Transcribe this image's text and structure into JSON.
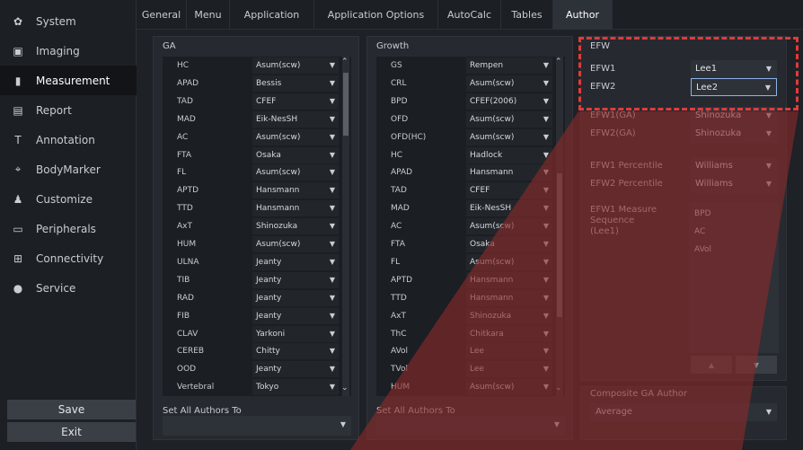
{
  "sidebar": {
    "items": [
      {
        "label": "System",
        "icon": "gear-icon"
      },
      {
        "label": "Imaging",
        "icon": "monitor-icon"
      },
      {
        "label": "Measurement",
        "icon": "bar-chart-icon"
      },
      {
        "label": "Report",
        "icon": "document-icon"
      },
      {
        "label": "Annotation",
        "icon": "text-icon"
      },
      {
        "label": "BodyMarker",
        "icon": "bodymarker-icon"
      },
      {
        "label": "Customize",
        "icon": "customize-icon"
      },
      {
        "label": "Peripherals",
        "icon": "printer-icon"
      },
      {
        "label": "Connectivity",
        "icon": "network-icon"
      },
      {
        "label": "Service",
        "icon": "service-icon"
      }
    ],
    "save_label": "Save",
    "exit_label": "Exit"
  },
  "tabs": [
    "General",
    "Menu",
    "Application",
    "Application Options",
    "AutoCalc",
    "Tables",
    "Author"
  ],
  "ga": {
    "title": "GA",
    "rows": [
      {
        "label": "HC",
        "value": "Asum(scw)"
      },
      {
        "label": "APAD",
        "value": "Bessis"
      },
      {
        "label": "TAD",
        "value": "CFEF"
      },
      {
        "label": "MAD",
        "value": "Eik-NesSH"
      },
      {
        "label": "AC",
        "value": "Asum(scw)"
      },
      {
        "label": "FTA",
        "value": "Osaka"
      },
      {
        "label": "FL",
        "value": "Asum(scw)"
      },
      {
        "label": "APTD",
        "value": "Hansmann"
      },
      {
        "label": "TTD",
        "value": "Hansmann"
      },
      {
        "label": "AxT",
        "value": "Shinozuka"
      },
      {
        "label": "HUM",
        "value": "Asum(scw)"
      },
      {
        "label": "ULNA",
        "value": "Jeanty"
      },
      {
        "label": "TIB",
        "value": "Jeanty"
      },
      {
        "label": "RAD",
        "value": "Jeanty"
      },
      {
        "label": "FIB",
        "value": "Jeanty"
      },
      {
        "label": "CLAV",
        "value": "Yarkoni"
      },
      {
        "label": "CEREB",
        "value": "Chitty"
      },
      {
        "label": "OOD",
        "value": "Jeanty"
      },
      {
        "label": "Vertebral",
        "value": "Tokyo"
      }
    ],
    "set_all_label": "Set All Authors To",
    "set_all_value": ""
  },
  "growth": {
    "title": "Growth",
    "rows": [
      {
        "label": "GS",
        "value": "Rempen"
      },
      {
        "label": "CRL",
        "value": "Asum(scw)"
      },
      {
        "label": "BPD",
        "value": "CFEF(2006)"
      },
      {
        "label": "OFD",
        "value": "Asum(scw)"
      },
      {
        "label": "OFD(HC)",
        "value": "Asum(scw)"
      },
      {
        "label": "HC",
        "value": "Hadlock"
      },
      {
        "label": "APAD",
        "value": "Hansmann"
      },
      {
        "label": "TAD",
        "value": "CFEF"
      },
      {
        "label": "MAD",
        "value": "Eik-NesSH"
      },
      {
        "label": "AC",
        "value": "Asum(scw)"
      },
      {
        "label": "FTA",
        "value": "Osaka"
      },
      {
        "label": "FL",
        "value": "Asum(scw)"
      },
      {
        "label": "APTD",
        "value": "Hansmann"
      },
      {
        "label": "TTD",
        "value": "Hansmann"
      },
      {
        "label": "AxT",
        "value": "Shinozuka"
      },
      {
        "label": "ThC",
        "value": "Chitkara"
      },
      {
        "label": "AVol",
        "value": "Lee"
      },
      {
        "label": "TVol",
        "value": "Lee"
      },
      {
        "label": "HUM",
        "value": "Asum(scw)"
      }
    ],
    "set_all_label": "Set All Authors To",
    "set_all_value": ""
  },
  "efw": {
    "title": "EFW",
    "rows": [
      {
        "label": "EFW1",
        "value": "Lee1"
      },
      {
        "label": "EFW2",
        "value": "Lee2"
      },
      {
        "label": "EFW1(GA)",
        "value": "Shinozuka"
      },
      {
        "label": "EFW2(GA)",
        "value": "Shinozuka"
      },
      {
        "label": "EFW1 Percentile",
        "value": "Williams"
      },
      {
        "label": "EFW2 Percentile",
        "value": "Williams"
      }
    ],
    "sequence_label": "EFW1 Measure Sequence\n(Lee1)",
    "sequence_items": [
      "BPD",
      "AC",
      "AVol"
    ],
    "up_arrow": "▲",
    "down_arrow": "▼"
  },
  "composite": {
    "title": "Composite GA Author",
    "value": "Average"
  },
  "glyphs": {
    "dropdown": "▼",
    "scroll_up": "⌃",
    "scroll_down": "⌄"
  },
  "colors": {
    "highlight": "#e23a3a",
    "overlay": "#8b2a2a"
  }
}
